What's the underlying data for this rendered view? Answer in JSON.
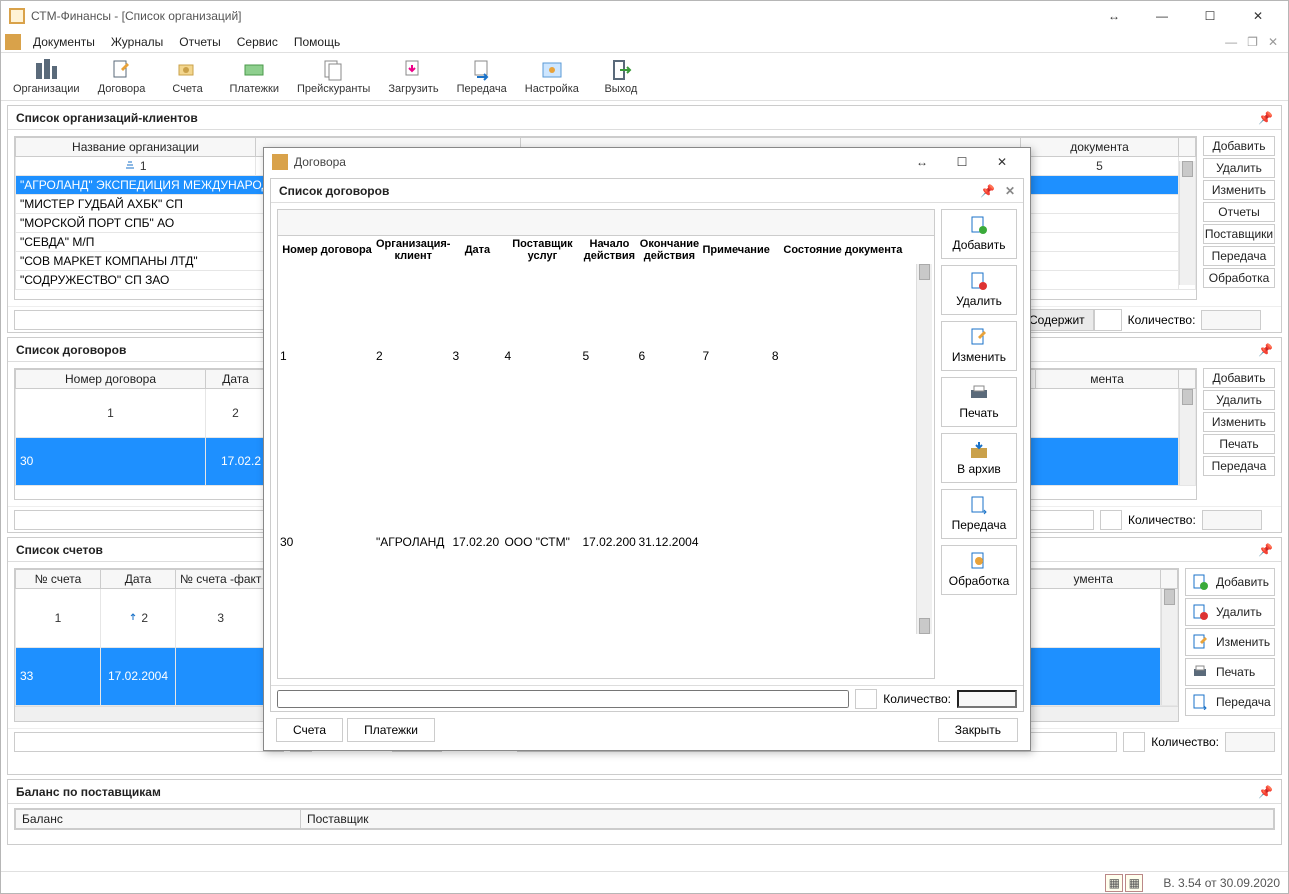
{
  "app": {
    "title": "СТМ-Финансы - [Список организаций]",
    "minimize": "—",
    "maximize": "☐",
    "close": "✕",
    "resize": "↔"
  },
  "menu": {
    "items": [
      "Документы",
      "Журналы",
      "Отчеты",
      "Сервис",
      "Помощь"
    ]
  },
  "toolbar": {
    "items": [
      "Организации",
      "Договора",
      "Счета",
      "Платежки",
      "Прейскуранты",
      "Загрузить",
      "Передача",
      "Настройка",
      "Выход"
    ]
  },
  "panels": {
    "org": {
      "title": "Список организаций-клиентов",
      "cols": {
        "c1": "Название организации",
        "c2": "документа",
        "idx1": "1",
        "idx2": "5"
      },
      "rows": [
        "\"АГРОЛАНД\" ЭКСПЕДИЦИЯ МЕЖДУНАРОДНАЯ",
        "\"МИСТЕР ГУДБАЙ АХБК\" СП",
        "\"МОРСКОЙ ПОРТ СПБ\" АО",
        "\"СЕВДА\" М/П",
        "\"СОВ МАРКЕТ КОМПАНЫ ЛТД\"",
        "\"СОДРУЖЕСТВО\" СП ЗАО"
      ],
      "buttons": [
        "Добавить",
        "Удалить",
        "Изменить",
        "Отчеты",
        "Поставщики",
        "Передача",
        "Обработка"
      ],
      "filter": {
        "contains": "Содержит",
        "qty": "Количество:"
      }
    },
    "contracts": {
      "title": "Список договоров",
      "cols": {
        "c1": "Номер договора",
        "c2": "Дата",
        "c3": "мента",
        "i1": "1",
        "i2": "2"
      },
      "row": {
        "num": "30",
        "date": "17.02.2"
      },
      "buttons": [
        "Добавить",
        "Удалить",
        "Изменить",
        "Печать",
        "Передача"
      ],
      "qty": "Количество:"
    },
    "invoices": {
      "title": "Список счетов",
      "cols": {
        "c1": "№ счета",
        "c2": "Дата",
        "c3": "№ счета -факт",
        "c4": "умента",
        "i1": "1",
        "i2": "2",
        "i3": "3"
      },
      "row": {
        "num": "33",
        "date": "17.02.2004"
      },
      "buttons": [
        "Добавить",
        "Удалить",
        "Изменить",
        "Печать",
        "Передача"
      ],
      "qty": "Количество:",
      "qty2": "Количество:"
    },
    "balance": {
      "title": "Баланс по поставщикам",
      "cols": {
        "c1": "Баланс",
        "c2": "Поставщик"
      }
    }
  },
  "dialog": {
    "title": "Договора",
    "subtitle": "Список договоров",
    "grid": {
      "headers": [
        "Номер договора",
        "Организация-клиент",
        "Дата",
        "Поставщик услуг",
        "Начало действия",
        "Окончание действия",
        "Примечание",
        "Состояние документа"
      ],
      "idx": [
        "1",
        "2",
        "3",
        "4",
        "5",
        "6",
        "7",
        "8"
      ],
      "row": {
        "c1": "30",
        "c2": "\"АГРОЛАНД",
        "c3": "17.02.20",
        "c4": "ООО \"СТМ\"",
        "c5": "17.02.200",
        "c6": "31.12.2004",
        "c7": "",
        "c8": ""
      }
    },
    "side": [
      "Добавить",
      "Удалить",
      "Изменить",
      "Печать",
      "В архив",
      "Передача",
      "Обработка"
    ],
    "qty": "Количество:",
    "footer": {
      "invoices": "Счета",
      "payments": "Платежки",
      "close": "Закрыть"
    }
  },
  "status": {
    "version": "В. 3.54 от 30.09.2020"
  }
}
